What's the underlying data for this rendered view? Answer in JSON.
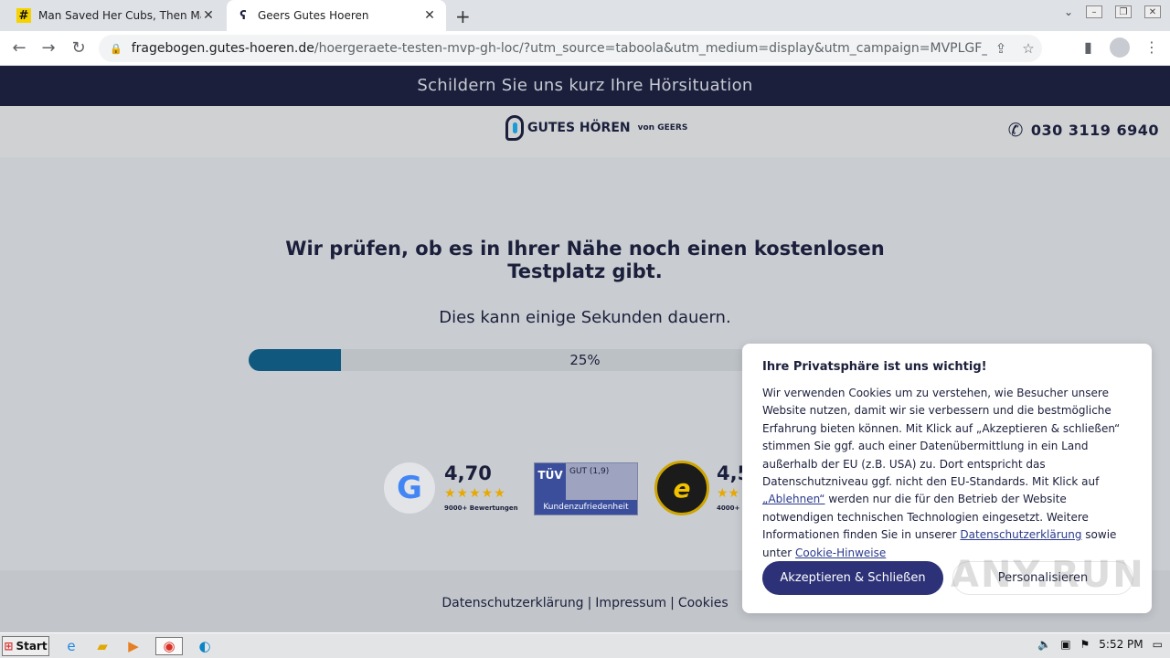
{
  "browser": {
    "tabs": [
      {
        "title": "Man Saved Her Cubs, Then Mama Be",
        "icon": "hashtag-icon"
      },
      {
        "title": "Geers Gutes Hoeren",
        "icon": "ear-icon"
      }
    ],
    "url_host": "fragebogen.gutes-hoeren.de",
    "url_path": "/hoergeraete-testen-mvp-gh-loc/?utm_source=taboola&utm_medium=display&utm_campaign=MVPLGF_DE_GTH_ACQ_DIS_..."
  },
  "banner": {
    "text": "Schildern Sie uns kurz Ihre Hörsituation"
  },
  "header": {
    "logo_text": "GUTES HÖREN",
    "logo_suffix": "von GEERS",
    "phone": "030 3119 6940"
  },
  "main": {
    "heading": "Wir prüfen, ob es in Ihrer Nähe noch einen kostenlosen Testplatz gibt.",
    "subheading": "Dies kann einige Sekunden dauern.",
    "progress_percent": 25,
    "progress_label": "25%"
  },
  "ratings": {
    "google_letter": "G",
    "google_score": "4,70",
    "google_stars": "★★★★★",
    "google_count": "9000+ Bewertungen",
    "tuv_logo": "TÜV",
    "tuv_grade": "GUT (1,9)",
    "tuv_label": "Kundenzufriedenheit",
    "ts_letter": "e",
    "ts_score": "4,5",
    "ts_stars": "★★",
    "ts_count": "4000+"
  },
  "footer": {
    "links": [
      "Datenschutzerklärung",
      "Impressum",
      "Cookies"
    ]
  },
  "cookie": {
    "title": "Ihre Privatsphäre ist uns wichtig!",
    "text_1": "Wir verwenden Cookies um zu verstehen, wie Besucher unsere Website nutzen, damit wir sie verbessern und die bestmögliche Erfahrung bieten können. Mit Klick auf „Akzeptieren & schließen“ stimmen Sie ggf. auch einer Datenübermittlung in ein Land außerhalb der EU (z.B. USA) zu. Dort entspricht das Datenschutzniveau ggf. nicht den EU-Standards. Mit Klick auf ",
    "link_reject": "„Ablehnen“",
    "text_2": " werden nur die für den Betrieb der Website notwendigen technischen Technologien eingesetzt. Weitere Informationen finden Sie in unserer ",
    "link_privacy": "Datenschutzerklärung",
    "text_3": " sowie unter ",
    "link_cookies": "Cookie-Hinweise",
    "accept_label": "Akzeptieren & Schließen",
    "personalize_label": "Personalisieren"
  },
  "watermark": "ANY.RUN",
  "taskbar": {
    "start_label": "Start",
    "clock": "5:52 PM"
  }
}
